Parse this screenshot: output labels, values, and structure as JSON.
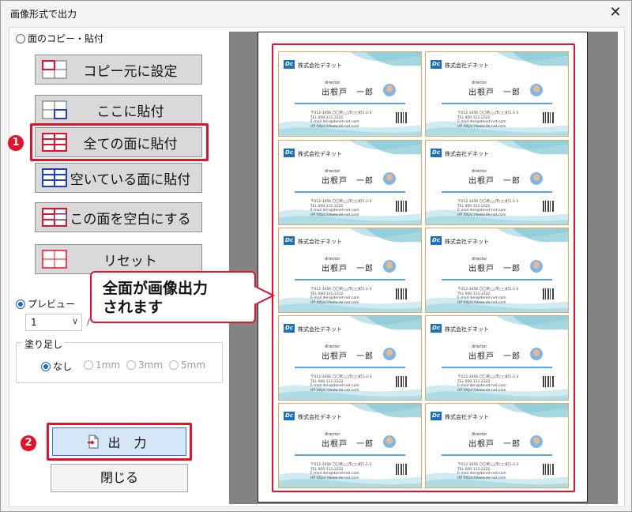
{
  "window": {
    "title": "画像形式で出力",
    "close_symbol": "✕"
  },
  "mode": {
    "copy_paste_label": "面のコピー・貼付",
    "preview_label": "プレビュー"
  },
  "buttons": {
    "set_copy_source": "コピー元に設定",
    "paste_here": "ここに貼付",
    "paste_all": "全ての面に貼付",
    "paste_empty": "空いている面に貼付",
    "make_blank": "この面を空白にする",
    "reset": "リセット"
  },
  "preview": {
    "page_value": "1",
    "page_sep": "/"
  },
  "bleed": {
    "label": "塗り足し",
    "options": [
      "なし",
      "1mm",
      "3mm",
      "5mm"
    ],
    "selected": "なし"
  },
  "actions": {
    "output": "出 力",
    "close": "閉じる"
  },
  "steps": {
    "step1": "1",
    "step2": "2"
  },
  "callout": {
    "line1": "全面が画像出力",
    "line2": "されます"
  },
  "card": {
    "logo": "Dc",
    "company": "株式会社デネット",
    "role": "director",
    "name": "出根戸　一郎",
    "address": "〒012-3456 〇〇県△△市□□町1-2-3",
    "tel": "TEL 000-111-2222",
    "email": "E-mail den@denet-net.com",
    "hp": "HP https://www.de-net.com"
  },
  "colors": {
    "accent_red": "#e5102c",
    "accent_blue": "#1e63c8",
    "preview_gray": "#838383"
  }
}
